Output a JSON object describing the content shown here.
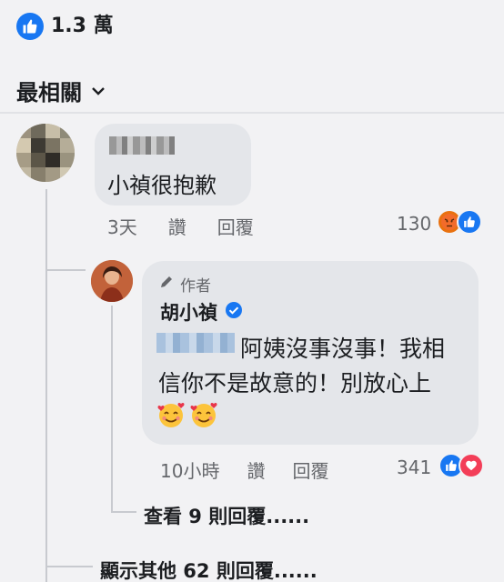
{
  "reactions": {
    "total_label": "1.3 萬"
  },
  "sort": {
    "label": "最相關"
  },
  "comment": {
    "text": "小禎很抱歉",
    "time": "3天",
    "like_action": "讚",
    "reply_action": "回覆",
    "reaction_count": "130",
    "reaction_icons": [
      "angry-icon",
      "like-icon"
    ]
  },
  "reply": {
    "author_badge": "作者",
    "name": "胡小禎",
    "text_line_1": "阿姨沒事沒事！我相",
    "text_line_2": "信你不是故意的！別放心上",
    "time": "10小時",
    "like_action": "讚",
    "reply_action": "回覆",
    "reaction_count": "341",
    "reaction_icons": [
      "like-icon",
      "love-icon"
    ]
  },
  "view_replies": "查看 9 則回覆......",
  "more_replies": "顯示其他 62 則回覆......",
  "colors": {
    "accent": "#1877f2",
    "bubble": "#e4e6ea",
    "love": "#f33e58",
    "angry": "#e9710f"
  }
}
